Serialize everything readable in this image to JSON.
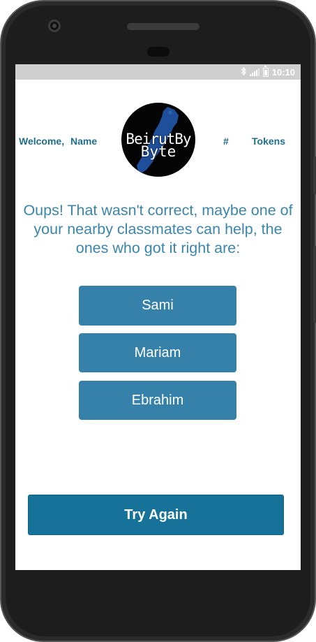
{
  "status_bar": {
    "time": "10:10",
    "icons": [
      "bluetooth-icon",
      "signal-icon",
      "battery-icon"
    ]
  },
  "header": {
    "welcome_word": "Welcome,",
    "user_name": "Name",
    "logo_line1": "BeirutBy",
    "logo_line2": "Byte",
    "token_count": "#",
    "tokens_label": "Tokens"
  },
  "message": "Oups! That wasn't correct, maybe one of your nearby classmates can help, the ones who got it right are:",
  "classmates": [
    "Sami",
    "Mariam",
    "Ebrahim"
  ],
  "actions": {
    "try_again": "Try Again"
  },
  "colors": {
    "primary_text": "#1f6e8e",
    "message_text": "#3a86ac",
    "name_button_bg": "#3581a9",
    "try_button_bg": "#177299",
    "status_bar_bg": "#cfcfcf",
    "logo_map": "#1f4f9a"
  }
}
